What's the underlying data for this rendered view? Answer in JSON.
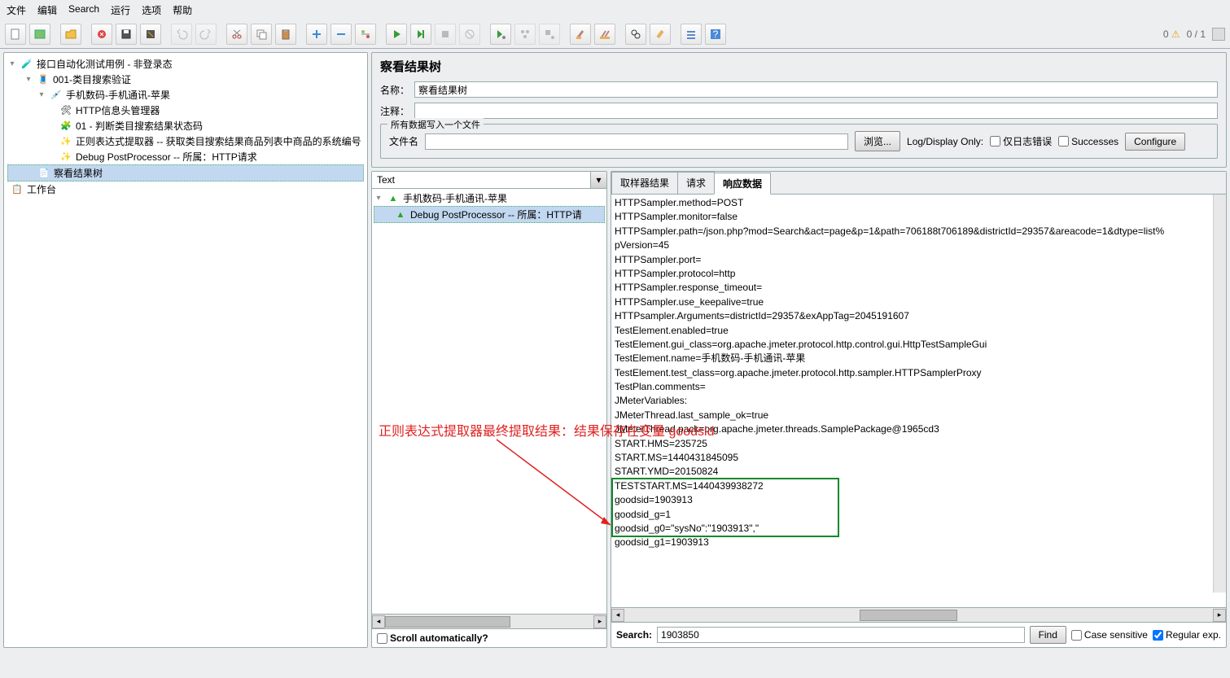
{
  "menu": [
    "文件",
    "编辑",
    "Search",
    "运行",
    "选项",
    "帮助"
  ],
  "toolbar_right": {
    "warn_count": "0",
    "ratio": "0 / 1"
  },
  "tree": {
    "root": "接口自动化测试用例 - 非登录态",
    "n1": "001-类目搜索验证",
    "n2": "手机数码-手机通讯-苹果",
    "n3": "HTTP信息头管理器",
    "n4": "01 - 判断类目搜索结果状态码",
    "n5": "正则表达式提取器 -- 获取类目搜索结果商品列表中商品的系统编号",
    "n6": "Debug PostProcessor -- 所属：HTTP请求",
    "n7": "察看结果树",
    "n8": "工作台"
  },
  "right": {
    "title": "察看结果树",
    "name_label": "名称：",
    "name_value": "察看结果树",
    "comment_label": "注释：",
    "fieldset_legend": "所有数据写入一个文件",
    "file_label": "文件名",
    "browse": "浏览...",
    "logdisplay": "Log/Display Only:",
    "only_errors": "仅日志错误",
    "successes": "Successes",
    "configure": "Configure"
  },
  "mid": {
    "dropdown_value": "Text",
    "r1": "手机数码-手机通讯-苹果",
    "r2": "Debug PostProcessor -- 所属：HTTP请",
    "scroll_auto": "Scroll automatically?"
  },
  "tabs": {
    "t1": "取样器结果",
    "t2": "请求",
    "t3": "响应数据"
  },
  "response_lines": [
    "HTTPSampler.method=POST",
    "HTTPSampler.monitor=false",
    "HTTPSampler.path=/json.php?mod=Search&act=page&p=1&path=706188t706189&districtId=29357&areacode=1&dtype=list%",
    "pVersion=45",
    "HTTPSampler.port=",
    "HTTPSampler.protocol=http",
    "HTTPSampler.response_timeout=",
    "HTTPSampler.use_keepalive=true",
    "HTTPsampler.Arguments=districtId=29357&exAppTag=2045191607",
    "TestElement.enabled=true",
    "TestElement.gui_class=org.apache.jmeter.protocol.http.control.gui.HttpTestSampleGui",
    "TestElement.name=手机数码-手机通讯-苹果",
    "TestElement.test_class=org.apache.jmeter.protocol.http.sampler.HTTPSamplerProxy",
    "TestPlan.comments=",
    "JMeterVariables:",
    "JMeterThread.last_sample_ok=true",
    "JMeterThread.pack=org.apache.jmeter.threads.SamplePackage@1965cd3",
    "START.HMS=235725",
    "START.MS=1440431845095",
    "START.YMD=20150824",
    "TESTSTART.MS=1440439938272",
    "goodsid=1903913",
    "goodsid_g=1",
    "goodsid_g0=\"sysNo\":\"1903913\",\"",
    "goodsid_g1=1903913"
  ],
  "search": {
    "label": "Search:",
    "value": "1903850",
    "find": "Find",
    "case": "Case sensitive",
    "regex": "Regular exp."
  },
  "annotation": "正则表达式提取器最终提取结果：结果保存在变量 goodsid"
}
